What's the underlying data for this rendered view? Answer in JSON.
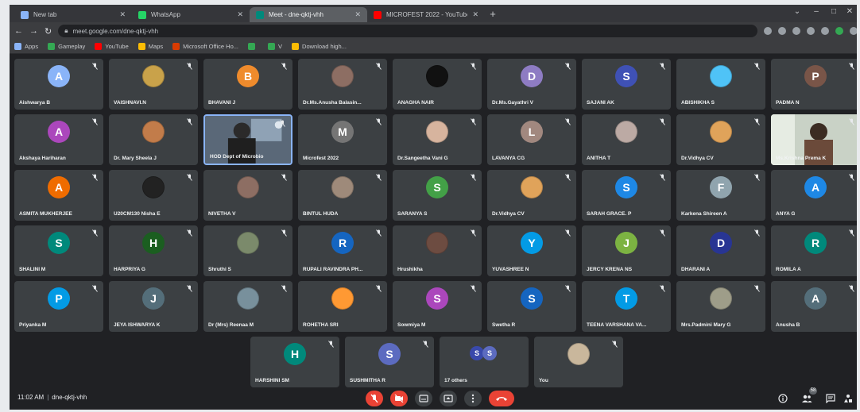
{
  "browser": {
    "tabs": [
      {
        "title": "New tab",
        "active": false,
        "favicon_color": "#8ab4f8"
      },
      {
        "title": "WhatsApp",
        "active": false,
        "favicon_color": "#25d366"
      },
      {
        "title": "Meet - dne-qktj-vhh",
        "active": true,
        "favicon_color": "#00897b"
      },
      {
        "title": "MICROFEST 2022 - YouTube",
        "active": false,
        "favicon_color": "#ff0000"
      }
    ],
    "new_tab_label": "+",
    "window_controls": [
      "⌄",
      "–",
      "□",
      "✕"
    ],
    "url": "meet.google.com/dne-qktj-vhh",
    "bookmarks": [
      {
        "label": "Apps",
        "color": "#8ab4f8"
      },
      {
        "label": "Gameplay",
        "color": "#34a853"
      },
      {
        "label": "YouTube",
        "color": "#ff0000"
      },
      {
        "label": "Maps",
        "color": "#fbbc04"
      },
      {
        "label": "Microsoft Office Ho...",
        "color": "#d83b01"
      },
      {
        "label": "",
        "color": "#34a853"
      },
      {
        "label": "V",
        "color": "#34a853"
      },
      {
        "label": "Download high...",
        "color": "#fbbc04"
      }
    ]
  },
  "participants": [
    {
      "name": "Aishwarya B",
      "initial": "A",
      "color": "#8ab4f8",
      "photo": false
    },
    {
      "name": "VAISHNAVI.N",
      "initial": "",
      "color": "#c9a24a",
      "photo": true
    },
    {
      "name": "BHAVANI J",
      "initial": "B",
      "color": "#ef8b2c",
      "photo": false
    },
    {
      "name": "Dr.Ms.Anusha Balasin...",
      "initial": "",
      "color": "#8d6e63",
      "photo": true
    },
    {
      "name": "ANAGHA NAIR",
      "initial": "",
      "color": "#111111",
      "photo": true
    },
    {
      "name": "Dr.Ms.Gayathri V",
      "initial": "D",
      "color": "#8e7cc3",
      "photo": false
    },
    {
      "name": "SAJANI AK",
      "initial": "S",
      "color": "#3f51b5",
      "photo": false
    },
    {
      "name": "ABISHIKHA S",
      "initial": "",
      "color": "#4fc3f7",
      "photo": true
    },
    {
      "name": "PADMA N",
      "initial": "P",
      "color": "#795548",
      "photo": false
    },
    {
      "name": "Akshaya Hariharan",
      "initial": "A",
      "color": "#ab47bc",
      "photo": false
    },
    {
      "name": "Dr. Mary Sheela J",
      "initial": "",
      "color": "#c27c4a",
      "photo": true
    },
    {
      "name": "HOD Dept of Microbio",
      "initial": "",
      "color": "#6f7c8a",
      "photo": true,
      "video": true
    },
    {
      "name": "Microfest 2022",
      "initial": "M",
      "color": "#757575",
      "photo": false
    },
    {
      "name": "Dr.Sangeetha Vani G",
      "initial": "",
      "color": "#d7b49e",
      "photo": true
    },
    {
      "name": "LAVANYA CG",
      "initial": "L",
      "color": "#a1887f",
      "photo": false
    },
    {
      "name": "ANITHA T",
      "initial": "",
      "color": "#bcaaa4",
      "photo": true
    },
    {
      "name": "Dr.Vidhya CV",
      "initial": "",
      "color": "#e0a35a",
      "photo": true
    },
    {
      "name": "Ms.Krishna Prema K",
      "initial": "",
      "color": "#b9c3b8",
      "photo": true,
      "video": true
    },
    {
      "name": "ASMITA MUKHERJEE",
      "initial": "A",
      "color": "#ef6c00",
      "photo": false
    },
    {
      "name": "U20CM130 Nisha E",
      "initial": "",
      "color": "#222222",
      "photo": true
    },
    {
      "name": "NIVETHA V",
      "initial": "",
      "color": "#8d6e63",
      "photo": true
    },
    {
      "name": "BINTUL HUDA",
      "initial": "",
      "color": "#9e8a7a",
      "photo": true
    },
    {
      "name": "SARANYA S",
      "initial": "S",
      "color": "#43a047",
      "photo": false
    },
    {
      "name": "Dr.Vidhya CV",
      "initial": "",
      "color": "#e0a35a",
      "photo": true
    },
    {
      "name": "SARAH GRACE. P",
      "initial": "S",
      "color": "#1e88e5",
      "photo": false
    },
    {
      "name": "Karkena Shireen A",
      "initial": "F",
      "color": "#90a4ae",
      "photo": false
    },
    {
      "name": "ANYA G",
      "initial": "A",
      "color": "#1e88e5",
      "photo": false
    },
    {
      "name": "SHALINI M",
      "initial": "S",
      "color": "#00897b",
      "photo": false
    },
    {
      "name": "HARPRIYA G",
      "initial": "H",
      "color": "#1b5e20",
      "photo": false
    },
    {
      "name": "Shruthi S",
      "initial": "",
      "color": "#7b8a6b",
      "photo": true
    },
    {
      "name": "RUPALI RAVINDRA PH...",
      "initial": "R",
      "color": "#1565c0",
      "photo": false
    },
    {
      "name": "Hrushikha",
      "initial": "",
      "color": "#6d4c41",
      "photo": true
    },
    {
      "name": "YUVASHREE N",
      "initial": "Y",
      "color": "#039be5",
      "photo": false
    },
    {
      "name": "JERCY KRENA NS",
      "initial": "J",
      "color": "#7cb342",
      "photo": false
    },
    {
      "name": "DHARANI A",
      "initial": "D",
      "color": "#283593",
      "photo": false
    },
    {
      "name": "ROMILA A",
      "initial": "R",
      "color": "#00897b",
      "photo": false
    },
    {
      "name": "Priyanka M",
      "initial": "P",
      "color": "#039be5",
      "photo": false
    },
    {
      "name": "JEYA ISHWARYA K",
      "initial": "J",
      "color": "#546e7a",
      "photo": false
    },
    {
      "name": "Dr (Mrs) Reenaa M",
      "initial": "",
      "color": "#78909c",
      "photo": true
    },
    {
      "name": "ROHETHA SRI",
      "initial": "",
      "color": "#ff9933",
      "photo": true
    },
    {
      "name": "Sowmiya M",
      "initial": "S",
      "color": "#ab47bc",
      "photo": false
    },
    {
      "name": "Swetha R",
      "initial": "S",
      "color": "#1565c0",
      "photo": false
    },
    {
      "name": "TEENA VARSHANA VA...",
      "initial": "T",
      "color": "#039be5",
      "photo": false
    },
    {
      "name": "Mrs.Padmini Mary G",
      "initial": "",
      "color": "#9e9d89",
      "photo": true
    },
    {
      "name": "Anusha B",
      "initial": "A",
      "color": "#546e7a",
      "photo": false
    },
    {
      "name": "HARSHINI SM",
      "initial": "H",
      "color": "#00897b",
      "photo": false
    },
    {
      "name": "SUSHMITHA R",
      "initial": "S",
      "color": "#5c6bc0",
      "photo": false
    },
    {
      "name": "17 others",
      "initial": "S",
      "color": "#3949ab",
      "photo": false,
      "others": true
    },
    {
      "name": "You",
      "initial": "",
      "color": "#c9b79c",
      "photo": true
    }
  ],
  "bottom_bar": {
    "time": "11:02 AM",
    "separator": "|",
    "meeting_code": "dne-qktj-vhh",
    "people_count": "58"
  }
}
